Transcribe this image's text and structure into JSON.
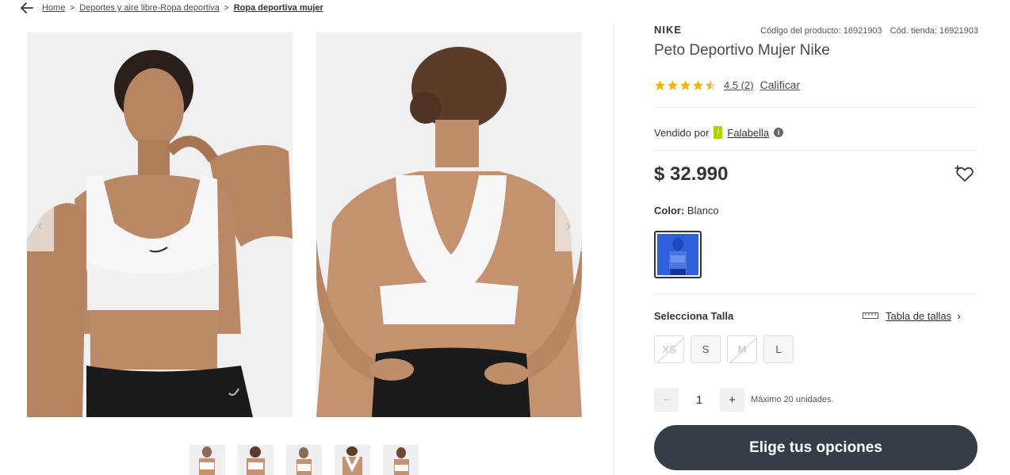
{
  "breadcrumb": {
    "items": [
      "Home",
      "Deportes y aire libre-Ropa deportiva",
      "Ropa deportiva mujer"
    ],
    "separator": ">"
  },
  "gallery": {
    "prev_icon": "chevron-left-icon",
    "next_icon": "chevron-right-icon",
    "thumbnail_count": 5
  },
  "product": {
    "brand": "NIKE",
    "product_code": "Código del producto: 16921903",
    "store_code": "Cód. tienda: 16921903",
    "title": "Peto Deportivo Mujer Nike",
    "rating": {
      "stars": 4.5,
      "score_text": "4.5 (2)",
      "rate_link": "Calificar"
    },
    "seller": {
      "prefix": "Vendido por",
      "flag_glyph": "/",
      "name": "Falabella",
      "info_glyph": "i"
    },
    "price": "$ 32.990",
    "color": {
      "label": "Color:",
      "value": "Blanco"
    },
    "size": {
      "label": "Selecciona Talla",
      "table_link": "Tabla de tallas",
      "options": [
        {
          "label": "XS",
          "available": false
        },
        {
          "label": "S",
          "available": true
        },
        {
          "label": "M",
          "available": false
        },
        {
          "label": "L",
          "available": true
        }
      ]
    },
    "quantity": {
      "minus": "−",
      "value": "1",
      "plus": "+",
      "max_text": "Máximo 20 unidades."
    },
    "cta": "Elige tus opciones"
  },
  "colors": {
    "accent_dark": "#343e48",
    "star": "#f5b301",
    "seller_flag": "#aad500",
    "swatch": "#2f5fd9"
  }
}
